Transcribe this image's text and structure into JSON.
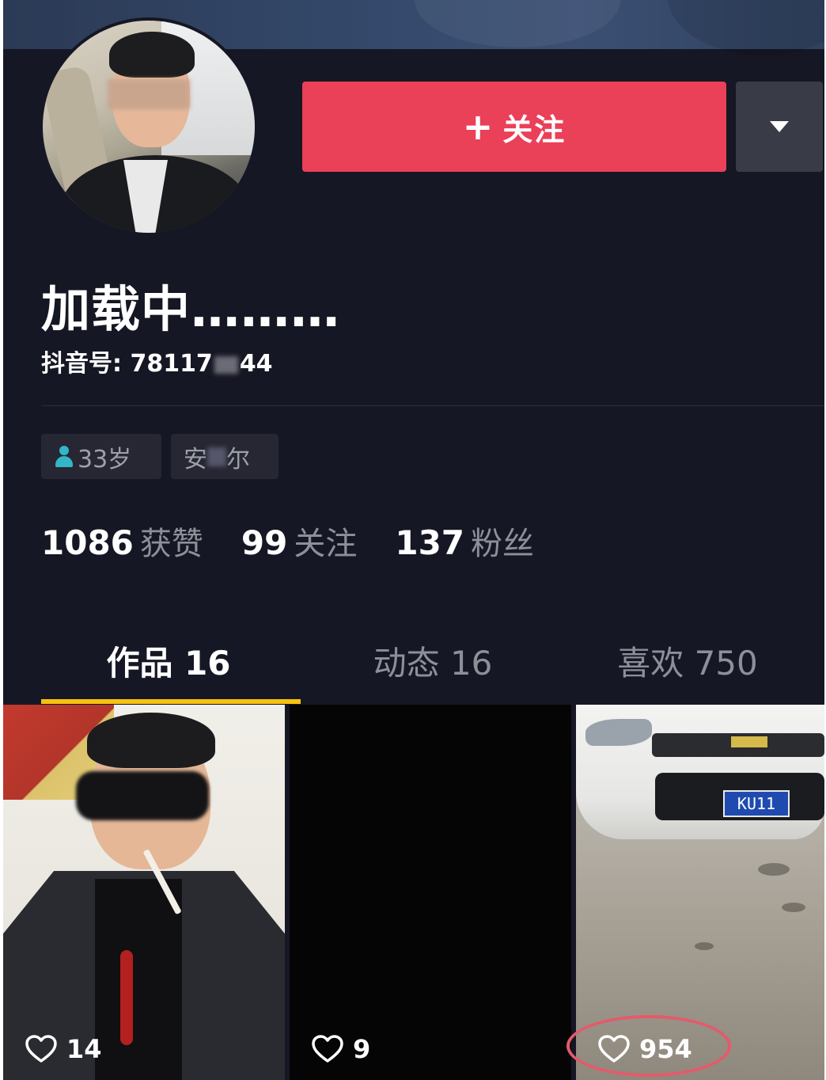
{
  "profile": {
    "nickname": "加载中………",
    "douyin_id_prefix": "抖音号: 78117",
    "douyin_id_suffix": "44",
    "follow_label": "关注",
    "follow_plus": "+",
    "tags": {
      "age": "33岁",
      "location_start": "安",
      "location_end": "尔"
    }
  },
  "stats": [
    {
      "num": "1086",
      "label": "获赞"
    },
    {
      "num": "99",
      "label": "关注"
    },
    {
      "num": "137",
      "label": "粉丝"
    }
  ],
  "tabs": [
    {
      "label": "作品 16",
      "active": true
    },
    {
      "label": "动态 16",
      "active": false
    },
    {
      "label": "喜欢 750",
      "active": false
    }
  ],
  "videos": [
    {
      "likes": "14"
    },
    {
      "likes": "9"
    },
    {
      "likes": "954",
      "plate": "KU11"
    }
  ],
  "colors": {
    "background": "#161724",
    "follow_button": "#ea4058",
    "tab_indicator": "#f6c20f",
    "highlight": "#e55a6a"
  }
}
